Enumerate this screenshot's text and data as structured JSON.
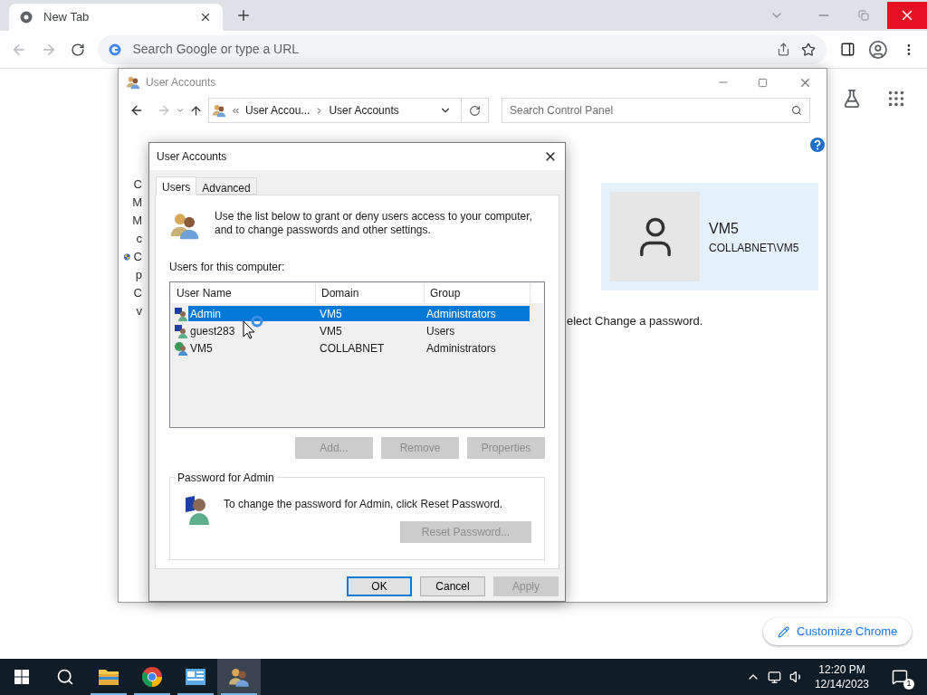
{
  "browser": {
    "tabs": [
      {
        "title": "New Tab",
        "selected": true
      }
    ],
    "omnibox": {
      "placeholder": "Search Google or type a URL"
    },
    "customize_button": "Customize Chrome"
  },
  "control_panel": {
    "title": "User Accounts",
    "breadcrumb": [
      "User Accou...",
      "User Accounts"
    ],
    "search": {
      "placeholder": "Search Control Panel"
    },
    "background_letters": [
      {
        "text": "C",
        "shield": false
      },
      {
        "text": "M",
        "shield": false
      },
      {
        "text": "M",
        "shield": false
      },
      {
        "text": "c",
        "shield": false
      },
      {
        "text": "C",
        "shield": true
      },
      {
        "text": "p",
        "shield": false
      },
      {
        "text": "C",
        "shield": false
      },
      {
        "text": "v",
        "shield": false
      }
    ],
    "tail_text": "elect Change a password.",
    "account": {
      "name": "VM5",
      "domain": "COLLABNET\\VM5"
    }
  },
  "dialog": {
    "title": "User Accounts",
    "tabs": [
      {
        "label": "Users",
        "selected": true
      },
      {
        "label": "Advanced",
        "selected": false
      }
    ],
    "intro": "Use the list below to grant or deny users access to your computer, and to change passwords and other settings.",
    "list_label": "Users for this computer:",
    "columns": [
      "User Name",
      "Domain",
      "Group"
    ],
    "rows": [
      {
        "kind": "local",
        "user": "Admin",
        "domain": "VM5",
        "group": "Administrators",
        "selected": true
      },
      {
        "kind": "local",
        "user": "guest283",
        "domain": "VM5",
        "group": "Users",
        "selected": false
      },
      {
        "kind": "domain",
        "user": "VM5",
        "domain": "COLLABNET",
        "group": "Administrators",
        "selected": false
      }
    ],
    "list_buttons": [
      {
        "label": "Add...",
        "disabled": true
      },
      {
        "label": "Remove",
        "disabled": true
      },
      {
        "label": "Properties",
        "disabled": true
      }
    ],
    "password_group": {
      "title": "Password for Admin",
      "text": "To change the password for Admin, click Reset Password.",
      "button": {
        "label": "Reset Password...",
        "disabled": true
      }
    },
    "footer_buttons": [
      {
        "label": "OK",
        "default": true,
        "disabled": false
      },
      {
        "label": "Cancel",
        "default": false,
        "disabled": false
      },
      {
        "label": "Apply",
        "default": false,
        "disabled": true
      }
    ]
  },
  "taskbar": {
    "apps": [
      {
        "kind": "explorer",
        "running": true,
        "selected": false
      },
      {
        "kind": "chrome",
        "running": true,
        "selected": false
      },
      {
        "kind": "control",
        "running": true,
        "selected": false
      },
      {
        "kind": "users",
        "running": true,
        "selected": true
      }
    ],
    "time": "12:20 PM",
    "date": "12/14/2023",
    "notifications": "1"
  }
}
